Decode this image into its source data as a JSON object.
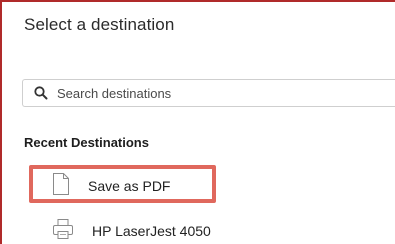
{
  "dialog": {
    "title": "Select a destination"
  },
  "search": {
    "placeholder": "Search destinations",
    "icon": "search-icon"
  },
  "recent": {
    "heading": "Recent Destinations",
    "items": [
      {
        "label": "Save as PDF",
        "icon": "document-icon",
        "highlighted": true
      },
      {
        "label": "HP LaserJest 4050",
        "icon": "printer-icon",
        "highlighted": false
      }
    ]
  },
  "colors": {
    "highlight": "#e0685d",
    "frame": "#b02a2a"
  }
}
